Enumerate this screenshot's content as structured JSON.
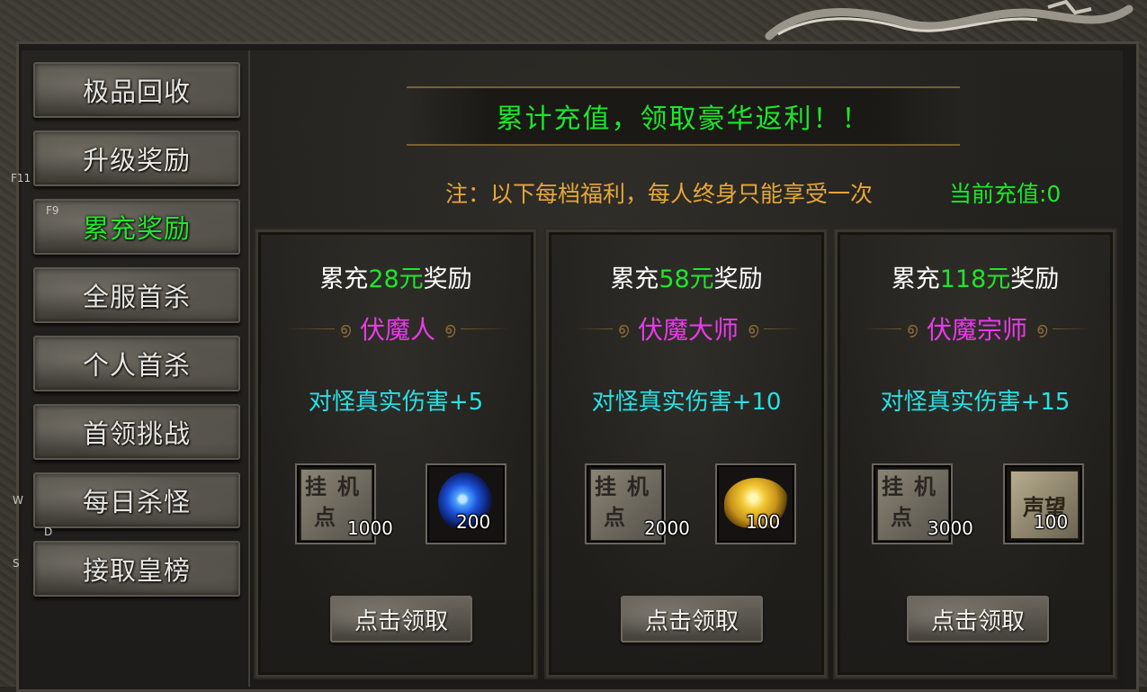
{
  "sidebar": {
    "items": [
      {
        "label": "极品回收",
        "active": false
      },
      {
        "label": "升级奖励",
        "active": false
      },
      {
        "label": "累充奖励",
        "active": true
      },
      {
        "label": "全服首杀",
        "active": false
      },
      {
        "label": "个人首杀",
        "active": false
      },
      {
        "label": "首领挑战",
        "active": false
      },
      {
        "label": "每日杀怪",
        "active": false
      },
      {
        "label": "接取皇榜",
        "active": false
      }
    ],
    "hotkeys": {
      "f11": "F11",
      "f9": "F9",
      "w": "W",
      "d": "D",
      "s": "S"
    }
  },
  "header": {
    "title": "累计充值，领取豪华返利！！",
    "note": "注：以下每档福利，每人终身只能享受一次",
    "current_recharge": "当前充值:0"
  },
  "cards": [
    {
      "title_prefix": "累充",
      "amount": "28元",
      "title_suffix": "奖励",
      "rank": "伏魔人",
      "bonus": "对怪真实伤害+5",
      "items": [
        {
          "icon": "guaji-point-icon",
          "count": "1000"
        },
        {
          "icon": "blue-orb-icon",
          "count": "200"
        }
      ],
      "claim_label": "点击领取"
    },
    {
      "title_prefix": "累充",
      "amount": "58元",
      "title_suffix": "奖励",
      "rank": "伏魔大师",
      "bonus": "对怪真实伤害+10",
      "items": [
        {
          "icon": "guaji-point-icon",
          "count": "2000"
        },
        {
          "icon": "gold-pile-icon",
          "count": "100"
        }
      ],
      "claim_label": "点击领取"
    },
    {
      "title_prefix": "累充",
      "amount": "118元",
      "title_suffix": "奖励",
      "rank": "伏魔宗师",
      "bonus": "对怪真实伤害+15",
      "items": [
        {
          "icon": "guaji-point-icon",
          "count": "3000"
        },
        {
          "icon": "reputation-icon",
          "count": "100"
        }
      ],
      "claim_label": "点击领取"
    }
  ],
  "icon_text": {
    "guaji_1": "挂",
    "guaji_2": "机",
    "guaji_3": "点",
    "reputation": "声望"
  },
  "colors": {
    "green": "#1ee62a",
    "orange": "#e6a638",
    "magenta": "#e83be8",
    "cyan": "#28e0e6"
  }
}
